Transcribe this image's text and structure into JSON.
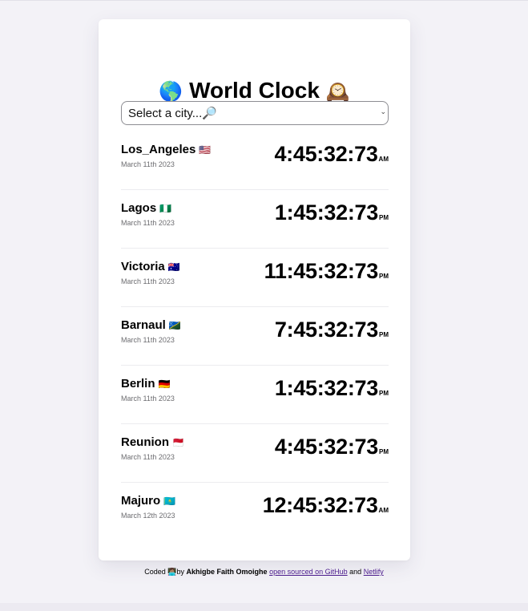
{
  "header": {
    "title": "World Clock",
    "globe_emoji": "🌎",
    "clock_emoji": "🕰️"
  },
  "select": {
    "label": "Select a city...🔎",
    "chevron": "⌄"
  },
  "cities": [
    {
      "name": "Los_Angeles",
      "flag": "🇺🇸",
      "date": "March 11th 2023",
      "time": "4:45:32:73",
      "ampm": "AM"
    },
    {
      "name": "Lagos",
      "flag": "🇳🇬",
      "date": "March 11th 2023",
      "time": "1:45:32:73",
      "ampm": "PM"
    },
    {
      "name": "Victoria",
      "flag": "🇦🇺",
      "date": "March 11th 2023",
      "time": "11:45:32:73",
      "ampm": "PM"
    },
    {
      "name": "Barnaul",
      "flag": "🇸🇧",
      "date": "March 11th 2023",
      "time": "7:45:32:73",
      "ampm": "PM"
    },
    {
      "name": "Berlin",
      "flag": "🇩🇪",
      "date": "March 11th 2023",
      "time": "1:45:32:73",
      "ampm": "PM"
    },
    {
      "name": "Reunion",
      "flag": "🇲🇨",
      "date": "March 11th 2023",
      "time": "4:45:32:73",
      "ampm": "PM"
    },
    {
      "name": "Majuro",
      "flag": "🇰🇿",
      "date": "March 12th 2023",
      "time": "12:45:32:73",
      "ampm": "AM"
    }
  ],
  "footer": {
    "prefix": "Coded",
    "coder_emoji": "👩🏽‍💻",
    "by": "by",
    "author": "Akhigbe Faith Omoighe",
    "github_link": "open sourced on GitHub",
    "and": "and",
    "netlify_link": "Netlify"
  }
}
